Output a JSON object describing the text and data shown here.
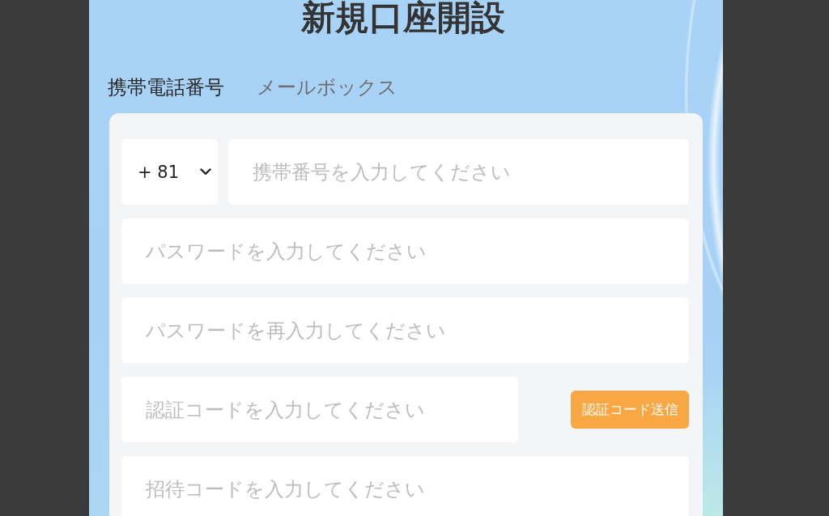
{
  "page": {
    "title": "新規口座開設"
  },
  "tabs": [
    {
      "label": "携帯電話番号",
      "selected": true
    },
    {
      "label": "メールボックス",
      "selected": false
    }
  ],
  "form": {
    "rows": [
      {
        "kind": "phone",
        "country_code": "+ 81",
        "placeholder": "携帯番号を入力してください"
      },
      {
        "kind": "plain",
        "placeholder": "パスワードを入力してください"
      },
      {
        "kind": "plain",
        "placeholder": "パスワードを再入力してください"
      },
      {
        "kind": "code",
        "placeholder": "認証コードを入力してください",
        "button": "認証コード送信"
      },
      {
        "kind": "plain",
        "placeholder": "招待コードを入力してください"
      }
    ]
  }
}
